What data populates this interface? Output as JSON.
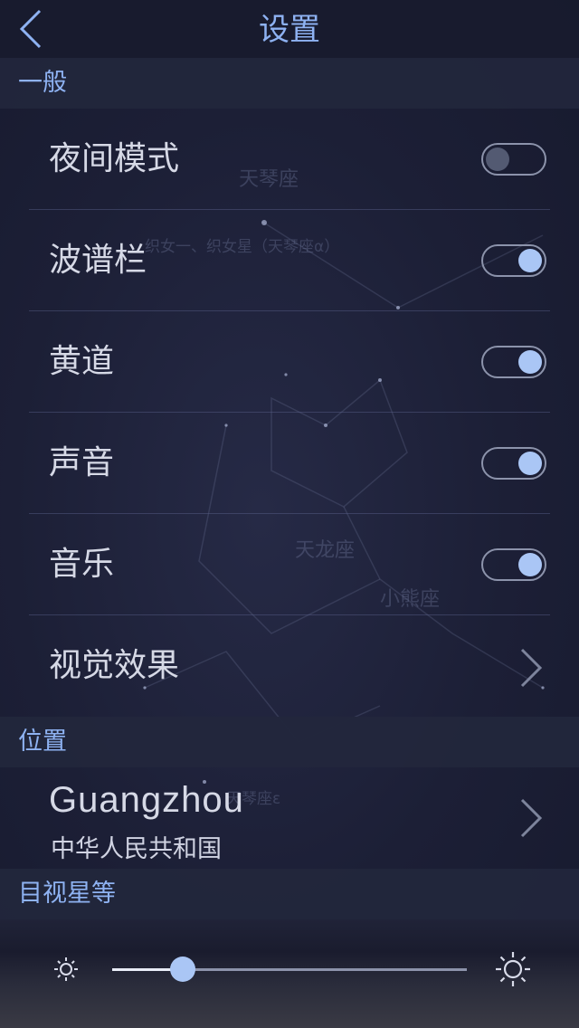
{
  "nav": {
    "title": "设置",
    "back_icon": "chevron-left-icon"
  },
  "colors": {
    "accent": "#8eb2f2",
    "toggle_on_knob": "#aac6f5",
    "toggle_off_knob": "#535a72",
    "background": "#1b1e33"
  },
  "background_labels": [
    "天琴座",
    "织女一、织女星（天琴座α）",
    "天龙座",
    "小熊座",
    "天琴座ε"
  ],
  "sections": {
    "general": {
      "header": "一般",
      "items": [
        {
          "label": "夜间模式",
          "control": "toggle",
          "on": false
        },
        {
          "label": "波谱栏",
          "control": "toggle",
          "on": true
        },
        {
          "label": "黄道",
          "control": "toggle",
          "on": true
        },
        {
          "label": "声音",
          "control": "toggle",
          "on": true
        },
        {
          "label": "音乐",
          "control": "toggle",
          "on": true
        },
        {
          "label": "视觉效果",
          "control": "disclosure"
        }
      ]
    },
    "location": {
      "header": "位置",
      "city": "Guangzhou",
      "country": "中华人民共和国"
    },
    "magnitude": {
      "header": "目视星等",
      "slider_value": 0.2,
      "min_icon": "sun-small-icon",
      "max_icon": "sun-large-icon"
    }
  }
}
